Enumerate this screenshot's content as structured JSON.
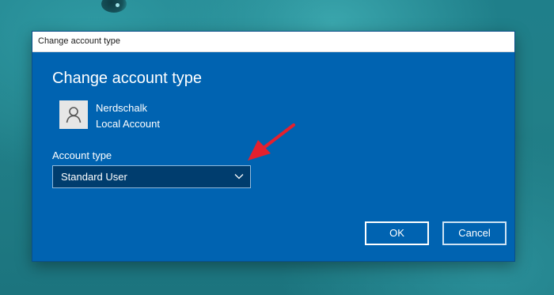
{
  "window": {
    "title": "Change account type"
  },
  "dialog": {
    "heading": "Change account type",
    "user": {
      "name": "Nerdschalk",
      "account_kind": "Local Account",
      "avatar_icon": "person-icon"
    },
    "account_type": {
      "label": "Account type",
      "selected": "Standard User"
    },
    "buttons": {
      "ok": "OK",
      "cancel": "Cancel"
    }
  },
  "colors": {
    "dialog_bg": "#0063b1",
    "dropdown_bg": "#003d6e",
    "annotation_arrow": "#e5202e"
  }
}
